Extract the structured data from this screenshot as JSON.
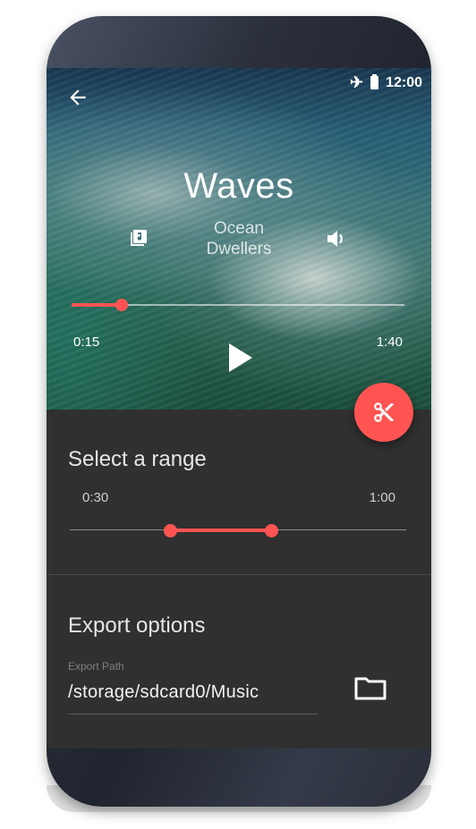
{
  "status_bar": {
    "time": "12:00",
    "icons": [
      "airplane-icon",
      "battery-icon"
    ]
  },
  "track": {
    "title": "Waves",
    "artist_line1": "Ocean",
    "artist_line2": "Dwellers",
    "current_time": "0:15",
    "total_time": "1:40",
    "progress_fraction": 0.15
  },
  "range": {
    "title": "Select a range",
    "start_label": "0:30",
    "end_label": "1:00",
    "start_fraction": 0.3,
    "end_fraction": 0.6
  },
  "export": {
    "title": "Export options",
    "path_label": "Export Path",
    "path_value": "/storage/sdcard0/Music"
  },
  "colors": {
    "accent": "#ff5452",
    "panel": "#303030"
  }
}
